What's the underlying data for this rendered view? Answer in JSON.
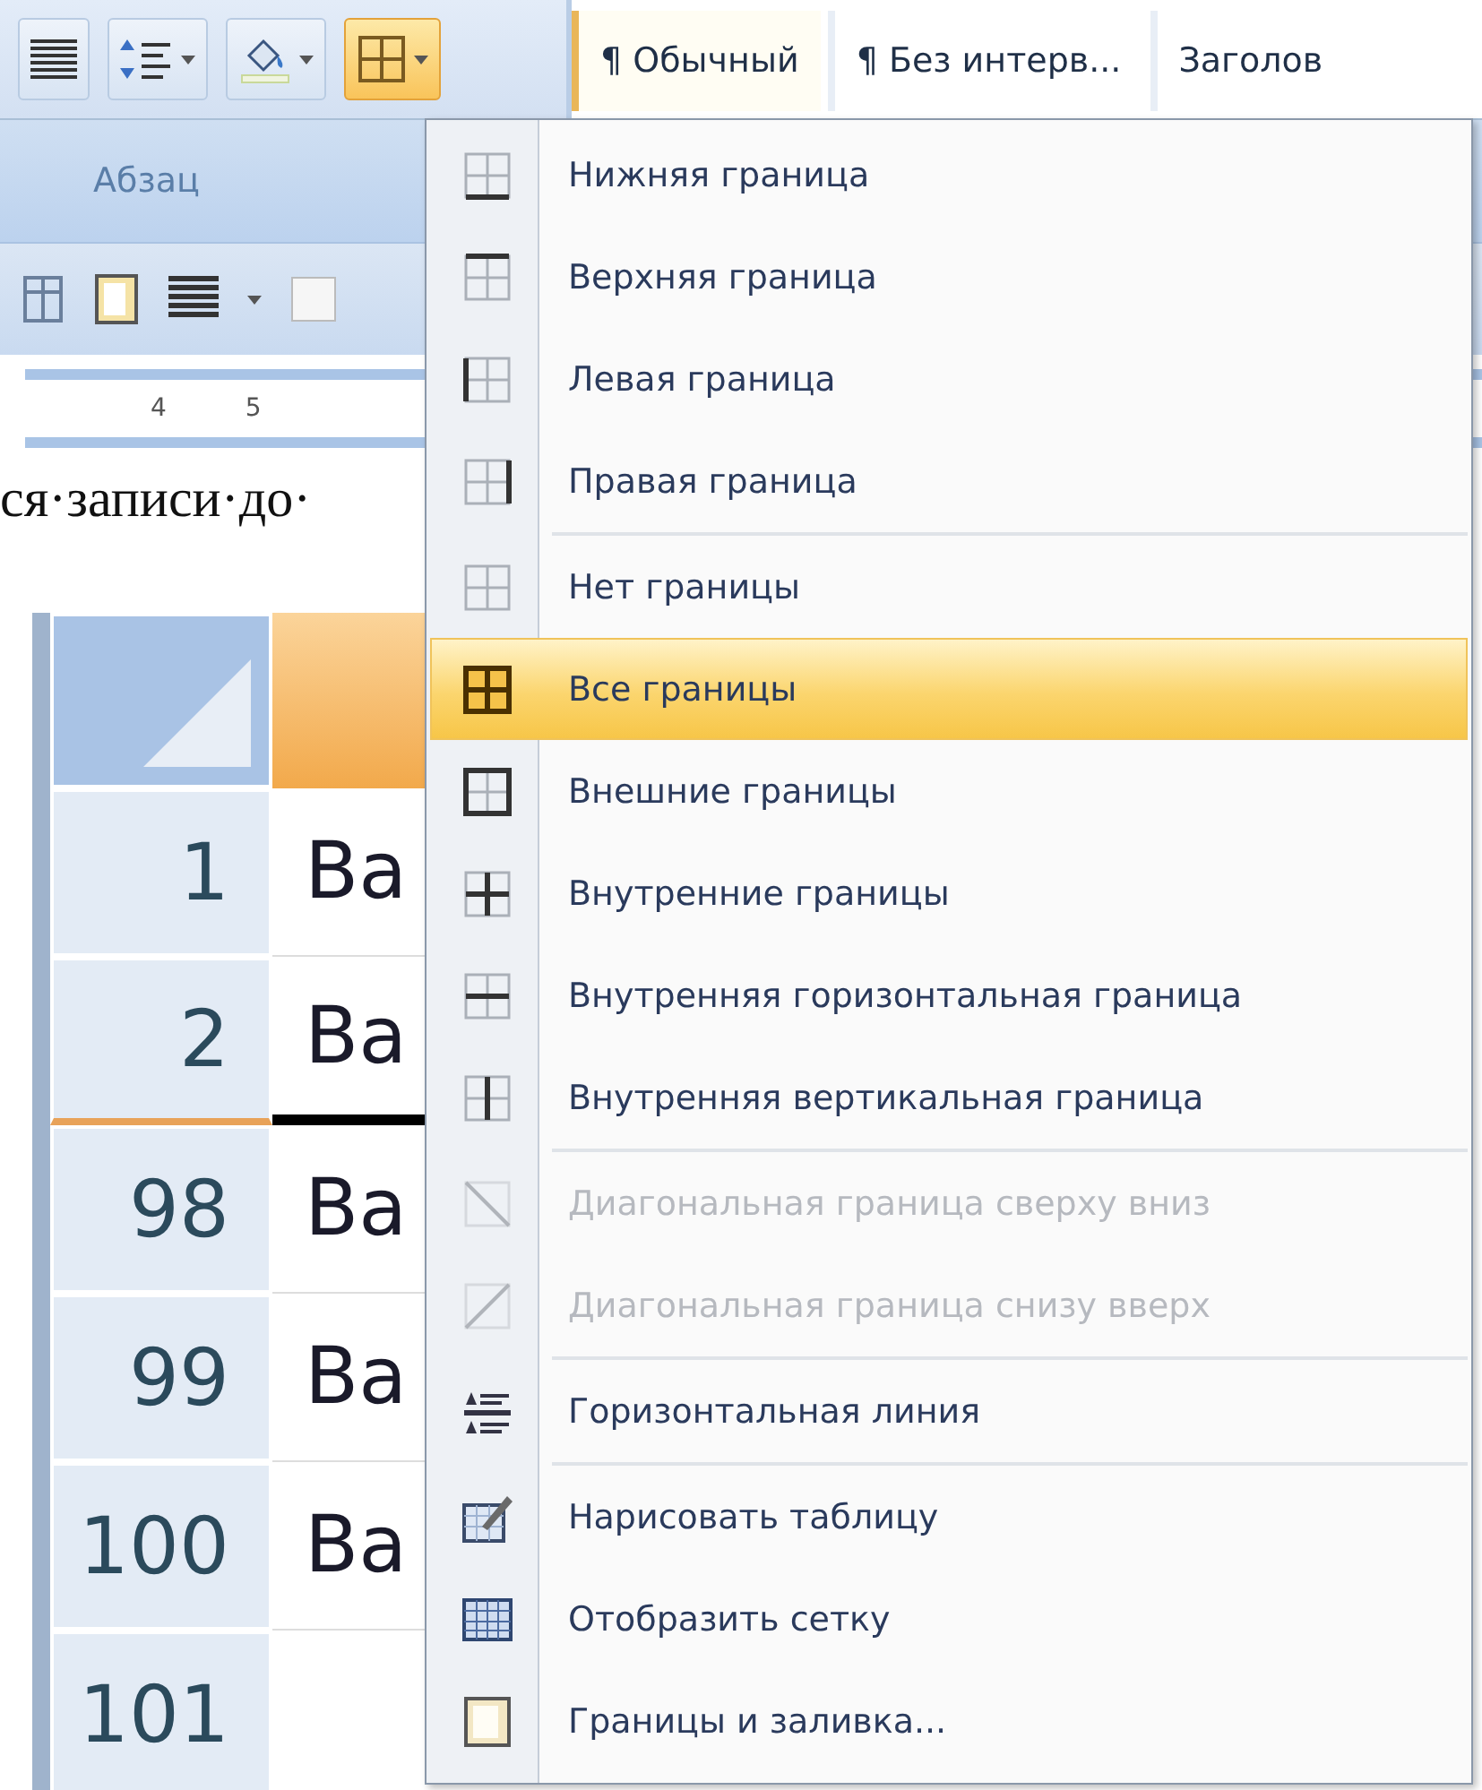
{
  "ribbon": {
    "buttons": [
      {
        "kind": "justify",
        "dropdown": false,
        "selected": false
      },
      {
        "kind": "line_spacing",
        "dropdown": true,
        "selected": false
      },
      {
        "kind": "shading",
        "dropdown": true,
        "selected": false
      },
      {
        "kind": "borders",
        "dropdown": true,
        "selected": true
      }
    ],
    "styles": [
      {
        "label": "¶ Обычный",
        "selected": true
      },
      {
        "label": "¶ Без интерв...",
        "selected": false
      },
      {
        "label": "Заголов",
        "selected": false
      }
    ],
    "group_label": "Абзац",
    "ruler": [
      "4",
      "5"
    ]
  },
  "document": {
    "text": "ся·записи·до·"
  },
  "table": {
    "rows": [
      {
        "number": "1",
        "value": "Ba",
        "marked": false
      },
      {
        "number": "2",
        "value": "Ba",
        "marked": true
      },
      {
        "number": "98",
        "value": "Ba",
        "marked": false
      },
      {
        "number": "99",
        "value": "Ba",
        "marked": false
      },
      {
        "number": "100",
        "value": "Ba",
        "marked": false
      },
      {
        "number": "101",
        "marked": false
      }
    ]
  },
  "menu": {
    "groups": [
      [
        {
          "kind": "bottom",
          "label": "Нижняя граница",
          "selected": false,
          "disabled": false
        },
        {
          "kind": "top",
          "label": "Верхняя граница",
          "selected": false,
          "disabled": false
        },
        {
          "kind": "left",
          "label": "Левая граница",
          "selected": false,
          "disabled": false
        },
        {
          "kind": "right",
          "label": "Правая граница",
          "selected": false,
          "disabled": false
        }
      ],
      [
        {
          "kind": "none",
          "label": "Нет границы",
          "selected": false,
          "disabled": false
        },
        {
          "kind": "all",
          "label": "Все границы",
          "selected": true,
          "disabled": false
        },
        {
          "kind": "outside",
          "label": "Внешние границы",
          "selected": false,
          "disabled": false
        },
        {
          "kind": "inside",
          "label": "Внутренние границы",
          "selected": false,
          "disabled": false
        },
        {
          "kind": "inside_h",
          "label": "Внутренняя горизонтальная граница",
          "selected": false,
          "disabled": false
        },
        {
          "kind": "inside_v",
          "label": "Внутренняя вертикальная граница",
          "selected": false,
          "disabled": false
        }
      ],
      [
        {
          "kind": "diag_down",
          "label": "Диагональная граница сверху вниз",
          "selected": false,
          "disabled": true
        },
        {
          "kind": "diag_up",
          "label": "Диагональная граница снизу вверх",
          "selected": false,
          "disabled": true
        }
      ],
      [
        {
          "kind": "hline",
          "label": "Горизонтальная линия",
          "selected": false,
          "disabled": false
        }
      ],
      [
        {
          "kind": "draw_table",
          "label": "Нарисовать таблицу",
          "selected": false,
          "disabled": false
        },
        {
          "kind": "gridlines",
          "label": "Отобразить сетку",
          "selected": false,
          "disabled": false
        },
        {
          "kind": "borders_shading",
          "label": "Границы и заливка...",
          "selected": false,
          "disabled": false
        }
      ]
    ]
  }
}
